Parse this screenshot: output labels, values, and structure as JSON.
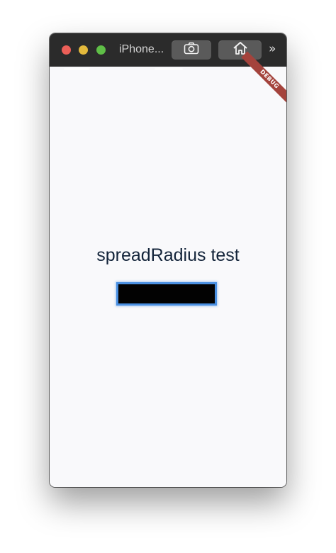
{
  "window": {
    "title": "iPhone...",
    "traffic_lights": {
      "close_color": "#ec5f58",
      "minimize_color": "#e3b93c",
      "maximize_color": "#5fbf47"
    },
    "toolbar": {
      "screenshot_icon": "camera-icon",
      "home_icon": "home-icon",
      "overflow_label": "»"
    }
  },
  "app": {
    "debug_banner": "DEBUG",
    "heading": "spreadRadius test",
    "box": {
      "fill_color": "#020202",
      "border_color": "#4a90e2"
    }
  }
}
